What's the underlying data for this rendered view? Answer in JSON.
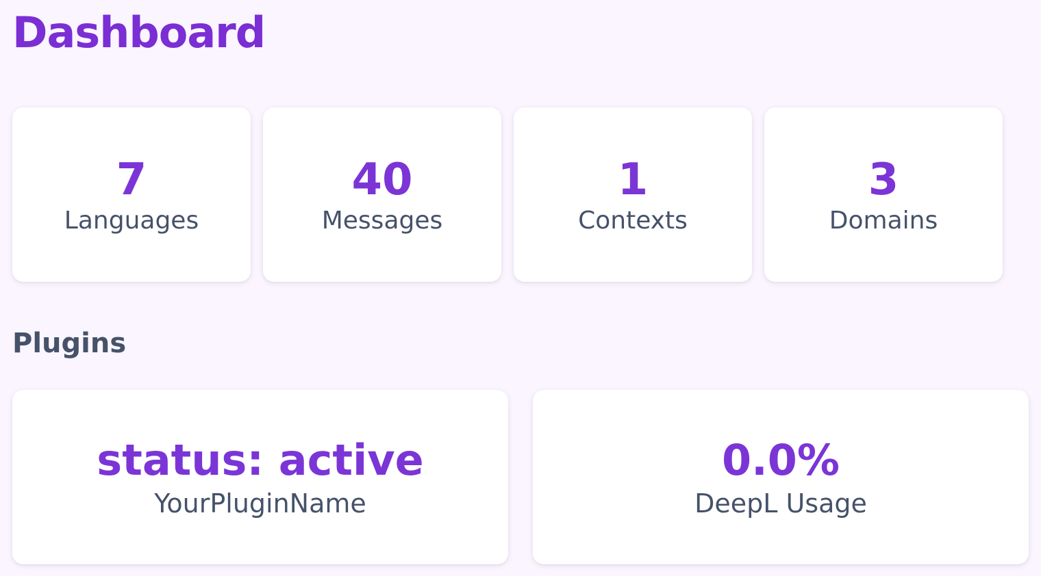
{
  "page": {
    "title": "Dashboard"
  },
  "stats": [
    {
      "value": "7",
      "label": "Languages"
    },
    {
      "value": "40",
      "label": "Messages"
    },
    {
      "value": "1",
      "label": "Contexts"
    },
    {
      "value": "3",
      "label": "Domains"
    }
  ],
  "plugins": {
    "title": "Plugins",
    "cards": [
      {
        "value": "status: active",
        "label": "YourPluginName"
      },
      {
        "value": "0.0%",
        "label": "DeepL Usage"
      }
    ]
  },
  "colors": {
    "accent": "#7b35d6",
    "text": "#46526a",
    "background": "#faf5fe",
    "card": "#ffffff"
  }
}
